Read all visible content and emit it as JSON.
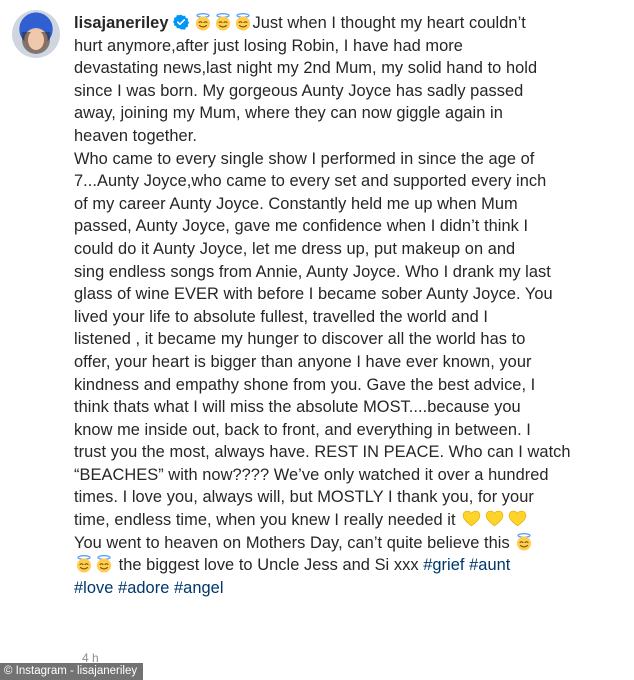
{
  "post": {
    "username": "lisajaneriley",
    "verified_icon": "verified-badge-icon",
    "emoji_halo": "smiling-face-with-halo-emoji",
    "emoji_heart": "yellow-heart-emoji",
    "lines": {
      "l1": "Just when I thought my heart couldn’t",
      "l2": "hurt anymore,after just losing Robin, I have had more",
      "l3": "devastating news,last night my 2nd Mum, my solid hand to hold",
      "l4": "since I was born. My gorgeous Aunty Joyce has sadly passed",
      "l5": "away, joining my Mum, where they can now giggle again in",
      "l6": "heaven together.",
      "l7": "Who came to every single show I performed in since the age of",
      "l8": "7...Aunty Joyce,who came to every set and supported every inch",
      "l9": "of my career Aunty Joyce. Constantly held me up when Mum",
      "l10": "passed, Aunty Joyce, gave me confidence when I didn’t think I",
      "l11": "could do it Aunty Joyce, let me dress up, put makeup on and",
      "l12": "sing endless songs from Annie, Aunty Joyce. Who I drank my last",
      "l13": "glass of wine EVER with before I became sober Aunty Joyce. You",
      "l14": "lived your life to absolute fullest, travelled the world and I",
      "l15": "listened , it became my hunger to discover all the world has to",
      "l16": "offer, your heart is bigger than anyone I have ever known, your",
      "l17": "kindness and empathy shone from you. Gave the best advice, I",
      "l18": "think thats what I will miss the absolute MOST....because you",
      "l19": "know me inside out, back to front, and everything in between. I",
      "l20": "trust you the most, always have. REST IN PEACE. Who can I watch",
      "l21": "“BEACHES” with now???? We’ve only watched it over a hundred",
      "l22": "times. I love you, always will, but MOSTLY I thank you, for your",
      "l23": "time, endless time, when you knew I really needed it",
      "l24": "You went to heaven on Mothers Day, can’t quite believe this",
      "l25": "the biggest love to Uncle Jess and Si xxx"
    },
    "hashtags": {
      "grief": "#grief",
      "aunt": "#aunt",
      "love": "#love",
      "adore": "#adore",
      "angel": "#angel"
    },
    "timestamp": "4 h"
  },
  "credit": "© Instagram - lisajaneriley",
  "colors": {
    "text": "#262626",
    "hashtag": "#00376b",
    "verified": "#0095f6",
    "muted": "#8e8e8e"
  }
}
